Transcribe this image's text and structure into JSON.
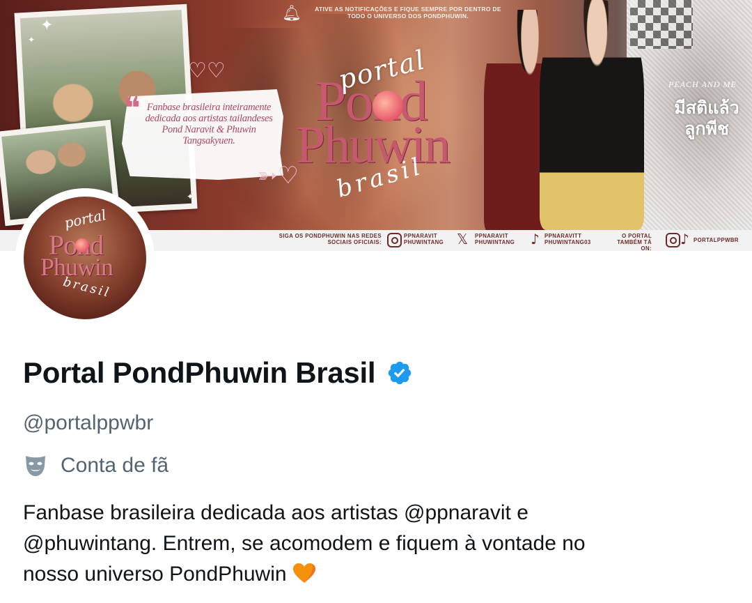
{
  "banner": {
    "notification_text": "ATIVE AS NOTIFICAÇÕES E FIQUE SEMPRE POR DENTRO DE TODO O UNIVERSO DOS PONDPHUWIN.",
    "quote": "Fanbase brasileira inteiramente dedicada aos artistas tailandeses Pond Naravit & Phuwin Tangsakyuen.",
    "logo_portal": "portal",
    "logo_pond": "Pond",
    "logo_phuwin": "Phuwin",
    "logo_brasil": "brasil",
    "peach_and_me": "PEACH AND ME",
    "thai_title": "มีสติแล้ว ลูกพีช",
    "social_intro": "SIGA OS PONDPHUWIN NAS REDES SOCIAIS OFICIAIS:",
    "instagram_handles": "PPNARAVIT PHUWINTANG",
    "x_handles": "PPNARAVIT PHUWINTANG",
    "tiktok_handles": "PPNARAVITT PHUWINTANG03",
    "portal_also_on": "O PORTAL TAMBÉM TÁ ON:",
    "portal_handle": "PORTALPPWBR"
  },
  "avatar": {
    "portal": "portal",
    "pond": "Pond",
    "phuwin": "Phuwin",
    "brasil": "brasil"
  },
  "profile": {
    "name": "Portal PondPhuwin Brasil",
    "handle": "@portalppwbr",
    "category_icon": "theater-mask-icon",
    "category": "Conta de fã",
    "bio_line1_a": "Fanbase brasileira dedicada aos artistas ",
    "bio_mention1": "@ppnaravit",
    "bio_line1_b": " e",
    "bio_mention2": "@phuwintang",
    "bio_line2": ". Entrem, se acomodem e fiquem à vontade no",
    "bio_line3": "nosso universo PondPhuwin",
    "verified_color": "#1d9bf0"
  }
}
